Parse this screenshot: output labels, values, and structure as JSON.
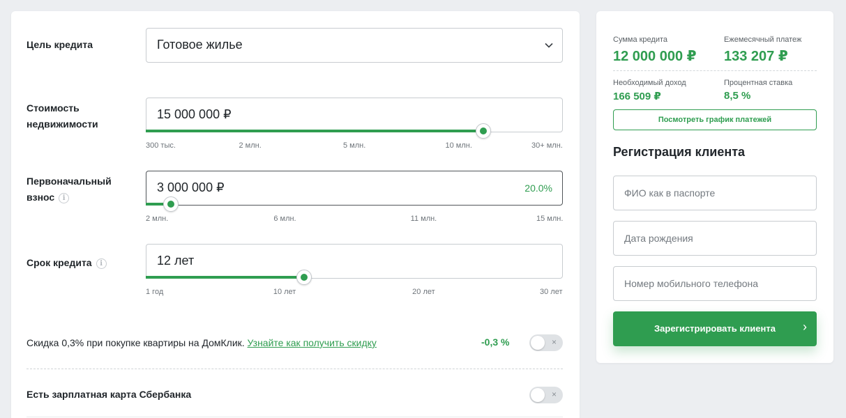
{
  "calculator": {
    "purpose": {
      "label": "Цель кредита",
      "value": "Готовое жилье"
    },
    "property_price": {
      "label_line1": "Стоимость",
      "label_line2": "недвижимости",
      "value": "15 000 000 ₽",
      "slider_fraction": 0.81,
      "ticks": [
        "300 тыс.",
        "2 млн.",
        "5 млн.",
        "10 млн.",
        "30+ млн."
      ]
    },
    "down_payment": {
      "label_line1": "Первоначальный",
      "label_line2": "взнос",
      "info_icon": "i",
      "value": "3 000 000 ₽",
      "percent": "20.0%",
      "slider_fraction": 0.06,
      "ticks": [
        "2 млн.",
        "6 млн.",
        "11 млн.",
        "15 млн."
      ]
    },
    "term": {
      "label": "Срок кредита",
      "info_icon": "i",
      "value": "12 лет",
      "slider_fraction": 0.38,
      "ticks": [
        "1 год",
        "10 лет",
        "20 лет",
        "30 лет"
      ]
    },
    "discount": {
      "text": "Скидка 0,3% при покупке квартиры на ДомКлик.",
      "link": "Узнайте как получить скидку",
      "value": "-0,3 %",
      "toggle_icon": "×",
      "enabled": false
    },
    "salary_card": {
      "text": "Есть зарплатная карта Сбербанка",
      "toggle_icon": "×",
      "enabled": false
    }
  },
  "summary": {
    "loan_amount_label": "Сумма кредита",
    "loan_amount": "12 000 000 ₽",
    "monthly_payment_label": "Ежемесячный платеж",
    "monthly_payment": "133 207 ₽",
    "required_income_label": "Необходимый доход",
    "required_income": "166 509 ₽",
    "rate_label": "Процентная ставка",
    "rate": "8,5 %",
    "schedule_button": "Посмотреть график платежей"
  },
  "registration": {
    "title": "Регистрация клиента",
    "name_placeholder": "ФИО как в паспорте",
    "birthdate_placeholder": "Дата рождения",
    "phone_placeholder": "Номер мобильного телефона",
    "submit_label": "Зарегистрировать клиента",
    "submit_icon": "›"
  },
  "colors": {
    "accent": "#2f9d50",
    "background": "#eceef1",
    "panel": "#ffffff"
  }
}
